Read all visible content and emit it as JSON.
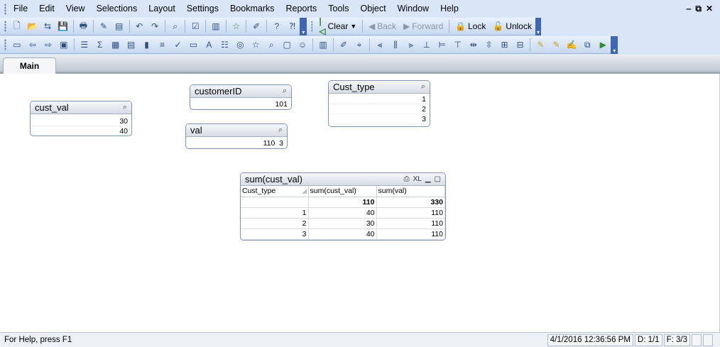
{
  "menubar": {
    "items": [
      "File",
      "Edit",
      "View",
      "Selections",
      "Layout",
      "Settings",
      "Bookmarks",
      "Reports",
      "Tools",
      "Object",
      "Window",
      "Help"
    ],
    "window_controls": [
      "‒",
      "⧉",
      "✕"
    ]
  },
  "toolbar_nav": {
    "clear_label": "Clear",
    "back_label": "Back",
    "forward_label": "Forward",
    "lock_label": "Lock",
    "unlock_label": "Unlock"
  },
  "tabs": [
    {
      "label": "Main"
    }
  ],
  "listboxes": {
    "cust_val": {
      "title": "cust_val",
      "values": [
        "30",
        "40"
      ]
    },
    "customerID": {
      "title": "customerID",
      "values": [
        "101"
      ]
    },
    "cust_type": {
      "title": "Cust_type",
      "values": [
        "1",
        "2",
        "3"
      ]
    },
    "val": {
      "title": "val",
      "values": [
        "110  3"
      ]
    }
  },
  "table": {
    "title": "sum(cust_val)",
    "icons": [
      "print-icon",
      "xl-export-icon",
      "minimize-icon",
      "maximize-icon"
    ],
    "xl_label": "XL",
    "columns": [
      "Cust_type",
      "sum(cust_val)",
      "sum(val)"
    ],
    "total_row": [
      "",
      "110",
      "330"
    ],
    "rows": [
      [
        "1",
        "40",
        "110"
      ],
      [
        "2",
        "30",
        "110"
      ],
      [
        "3",
        "40",
        "110"
      ]
    ]
  },
  "statusbar": {
    "help_text": "For Help, press F1",
    "datetime": "4/1/2016 12:36:56 PM",
    "d_count": "D: 1/1",
    "f_count": "F: 3/3"
  },
  "colors": {
    "menubar_bg": "#d9e6f8",
    "toolbar_end": "#3e66b2",
    "box_border": "#7f94b2"
  }
}
